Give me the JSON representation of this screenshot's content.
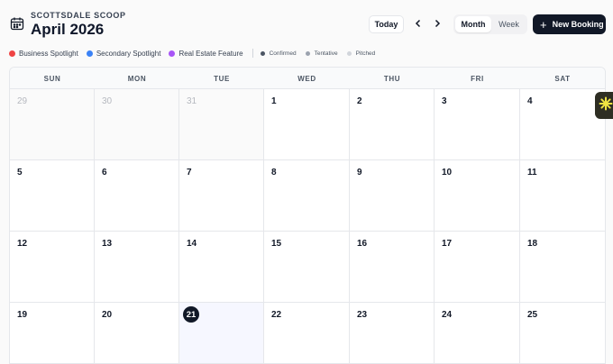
{
  "header": {
    "brand": "SCOTTSDALE SCOOP",
    "title": "April 2026",
    "today_label": "Today",
    "view_options": [
      "Month",
      "Week"
    ],
    "active_view": "Month",
    "new_booking_label": "New Booking",
    "icons": {
      "calendar": "calendar-icon",
      "prev": "chevron-left-icon",
      "next": "chevron-right-icon",
      "plus": "plus-icon"
    }
  },
  "legend": {
    "categories": [
      {
        "label": "Business Spotlight",
        "color": "#ef4444"
      },
      {
        "label": "Secondary Spotlight",
        "color": "#3b82f6"
      },
      {
        "label": "Real Estate Feature",
        "color": "#a855f7"
      }
    ],
    "statuses": [
      {
        "label": "Confirmed",
        "color": "#4b5563"
      },
      {
        "label": "Tentative",
        "color": "#9ca3af"
      },
      {
        "label": "Pitched",
        "color": "#d1d5db"
      }
    ]
  },
  "calendar": {
    "weekdays": [
      "SUN",
      "MON",
      "TUE",
      "WED",
      "THU",
      "FRI",
      "SAT"
    ],
    "today": "21",
    "weeks": [
      [
        {
          "d": "29",
          "out": true
        },
        {
          "d": "30",
          "out": true
        },
        {
          "d": "31",
          "out": true
        },
        {
          "d": "1"
        },
        {
          "d": "2"
        },
        {
          "d": "3"
        },
        {
          "d": "4"
        }
      ],
      [
        {
          "d": "5"
        },
        {
          "d": "6"
        },
        {
          "d": "7"
        },
        {
          "d": "8"
        },
        {
          "d": "9"
        },
        {
          "d": "10"
        },
        {
          "d": "11"
        }
      ],
      [
        {
          "d": "12"
        },
        {
          "d": "13"
        },
        {
          "d": "14"
        },
        {
          "d": "15"
        },
        {
          "d": "16"
        },
        {
          "d": "17"
        },
        {
          "d": "18"
        }
      ],
      [
        {
          "d": "19"
        },
        {
          "d": "20"
        },
        {
          "d": "21",
          "today": true
        },
        {
          "d": "22"
        },
        {
          "d": "23"
        },
        {
          "d": "24"
        },
        {
          "d": "25"
        }
      ]
    ]
  },
  "side_widget": {
    "icon": "sparkle-icon",
    "accent": "#f0e442"
  }
}
